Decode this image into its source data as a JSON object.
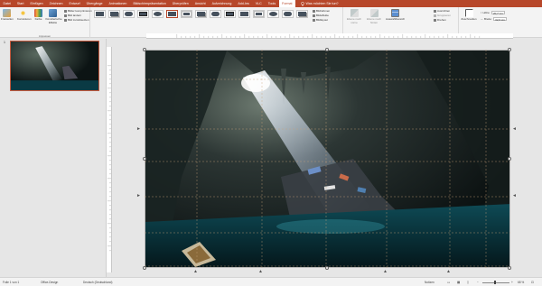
{
  "ribbon": {
    "tabs": [
      "Datei",
      "Start",
      "Einfügen",
      "Zeichnen",
      "Entwurf",
      "Übergänge",
      "Animationen",
      "Bildschirmpräsentation",
      "Überprüfen",
      "Ansicht",
      "Aufzeichnung",
      "Add-Ins",
      "VLC",
      "Tools",
      "Format"
    ],
    "active_tab": "Format",
    "tell_me": "Was möchten Sie tun?",
    "adjust": {
      "freistellen": "Freistellen",
      "korrekturen": "Korrekturen",
      "farbe": "Farbe",
      "kuenstlerische_effekte": "Künstlerische Effekte",
      "bilder_komprimieren": "Bilder komprimieren",
      "bild_aendern": "Bild ändern",
      "bild_zuruecksetzen": "Bild zurücksetzen",
      "label": "Anpassen"
    },
    "styles": {
      "label": "Bildformatvorlagen",
      "bildrahmen": "Bildrahmen",
      "bildeffekte": "Bildeffekte",
      "bildlayout": "Bildlayout"
    },
    "arrange": {
      "label": "Anordnen",
      "ebene_nach_vorne": "Ebene nach vorne",
      "ebene_nach_hinten": "Ebene nach hinten",
      "auswahlbereich": "Auswahlbereich",
      "ausrichten": "Ausrichten",
      "gruppieren": "Gruppieren",
      "drehen": "Drehen"
    },
    "size": {
      "label": "Größe",
      "zuschneiden": "Zuschneiden",
      "hoehe_label": "Höhe:",
      "hoehe": "20,7 cm",
      "breite_label": "Breite:",
      "breite": "32,6 cm"
    }
  },
  "thumbnails": {
    "slide_number": "1"
  },
  "status": {
    "slide_info": "Folie 1 von 1",
    "theme": "Office-Design",
    "language": "Deutsch (Deutschland)",
    "notes": "Notizen",
    "zoom": "68 %"
  }
}
